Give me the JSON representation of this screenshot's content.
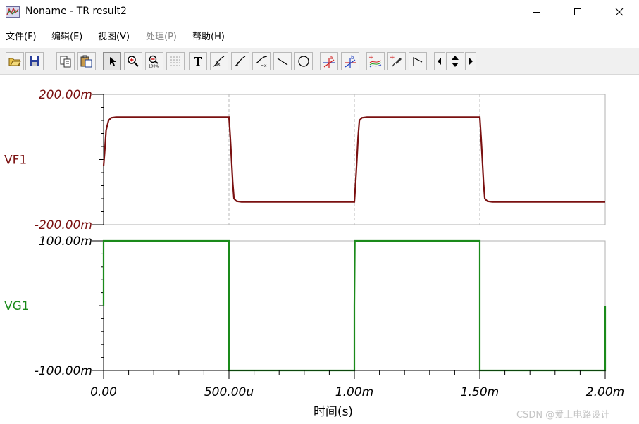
{
  "window": {
    "title": "Noname - TR result2",
    "buttons": [
      "minimize",
      "maximize",
      "close"
    ]
  },
  "menu": {
    "items": [
      {
        "label": "文件(F)",
        "enabled": true
      },
      {
        "label": "编辑(E)",
        "enabled": true
      },
      {
        "label": "视图(V)",
        "enabled": true
      },
      {
        "label": "处理(P)",
        "enabled": false
      },
      {
        "label": "帮助(H)",
        "enabled": true
      }
    ]
  },
  "toolbar": {
    "buttons": [
      "open-icon",
      "save-icon",
      "copy-icon",
      "paste-icon",
      "pointer-icon",
      "zoom-in-icon",
      "zoom-100-icon",
      "grid-icon",
      "text-icon",
      "cursor-a-icon",
      "cursor-b-icon",
      "curve-label-icon",
      "line-icon",
      "circle-icon",
      "marker-a-icon",
      "marker-b-icon",
      "add-trace-icon",
      "probe-icon",
      "axis-icon",
      "scroll-left-icon",
      "scroll-updown-icon",
      "scroll-right-icon"
    ]
  },
  "colors": {
    "vf1": "#7a1010",
    "vg1": "#1a8a1a",
    "grid": "#b0b0b0",
    "axis": "#000000"
  },
  "chart_data": {
    "type": "line",
    "xlabel": "时间(s)",
    "x_unit": "s",
    "xlim": [
      0,
      0.002
    ],
    "x_tick_values": [
      0,
      0.0005,
      0.001,
      0.0015,
      0.002
    ],
    "x_tick_labels": [
      "0.00",
      "500.00u",
      "1.00m",
      "1.50m",
      "2.00m"
    ],
    "panels": [
      {
        "name": "VF1",
        "ylim": [
          -0.2,
          0.2
        ],
        "y_tick_labels": [
          "200.00m",
          "-200.00m"
        ],
        "color": "#7a1010",
        "points": [
          [
            0,
            -0.02
          ],
          [
            5e-06,
            0.03
          ],
          [
            1e-05,
            0.09
          ],
          [
            2e-05,
            0.12
          ],
          [
            3e-05,
            0.128
          ],
          [
            5e-05,
            0.13
          ],
          [
            0.0005,
            0.13
          ],
          [
            0.000505,
            0.07
          ],
          [
            0.00051,
            0.0
          ],
          [
            0.000515,
            -0.07
          ],
          [
            0.00052,
            -0.12
          ],
          [
            0.00053,
            -0.128
          ],
          [
            0.00055,
            -0.13
          ],
          [
            0.001,
            -0.13
          ],
          [
            0.001005,
            -0.07
          ],
          [
            0.00101,
            0.0
          ],
          [
            0.001015,
            0.07
          ],
          [
            0.00102,
            0.12
          ],
          [
            0.00103,
            0.128
          ],
          [
            0.00105,
            0.13
          ],
          [
            0.0015,
            0.13
          ],
          [
            0.001505,
            0.07
          ],
          [
            0.00151,
            0.0
          ],
          [
            0.001515,
            -0.07
          ],
          [
            0.00152,
            -0.12
          ],
          [
            0.00153,
            -0.128
          ],
          [
            0.00155,
            -0.13
          ],
          [
            0.002,
            -0.13
          ]
        ]
      },
      {
        "name": "VG1",
        "ylim": [
          -0.1,
          0.1
        ],
        "y_tick_labels": [
          "100.00m",
          "-100.00m"
        ],
        "color": "#1a8a1a",
        "points": [
          [
            0,
            0
          ],
          [
            0,
            0.1
          ],
          [
            0.0005,
            0.1
          ],
          [
            0.0005,
            -0.1
          ],
          [
            0.001,
            -0.1
          ],
          [
            0.001,
            0
          ],
          [
            0.001002,
            0.1
          ],
          [
            0.0015,
            0.1
          ],
          [
            0.0015,
            -0.1
          ],
          [
            0.002,
            -0.1
          ],
          [
            0.002,
            0
          ]
        ]
      }
    ]
  },
  "watermark": "CSDN @爱上电路设计"
}
